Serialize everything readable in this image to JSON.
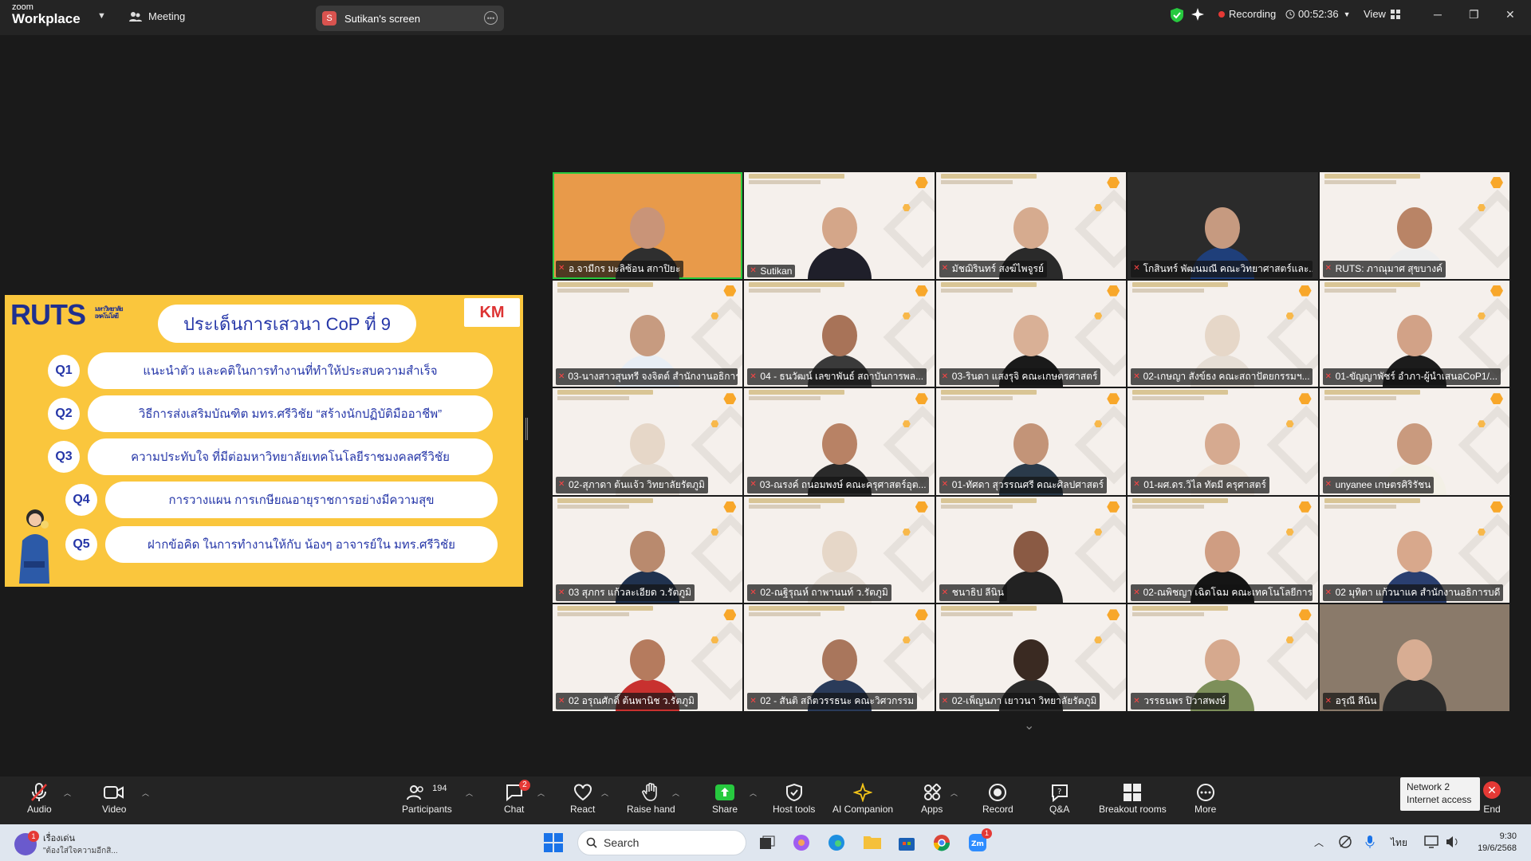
{
  "app": {
    "brand_small": "zoom",
    "brand_big": "Workplace",
    "meeting_label": "Meeting"
  },
  "share_tab": {
    "initial": "S",
    "title": "Sutikan's screen"
  },
  "status": {
    "recording": "Recording",
    "timer": "00:52:36",
    "view": "View"
  },
  "slide": {
    "logo": "RUTS",
    "logo_sub": "มหาวิทยาลัยเทคโนโลยี",
    "km_logo": "KM",
    "title": "ประเด็นการเสวนา CoP ที่ 9",
    "questions": [
      {
        "id": "Q1",
        "text": "แนะนำตัว และคติในการทำงานที่ทำให้ประสบความสำเร็จ"
      },
      {
        "id": "Q2",
        "text": "วิธีการส่งเสริมบัณฑิต มทร.ศรีวิชัย “สร้างนักปฏิบัติมืออาชีพ”"
      },
      {
        "id": "Q3",
        "text": "ความประทับใจ ที่มีต่อมหาวิทยาลัยเทคโนโลยีราชมงคลศรีวิชัย"
      },
      {
        "id": "Q4",
        "text": "การวางแผน การเกษียณอายุราชการอย่างมีความสุข"
      },
      {
        "id": "Q5",
        "text": "ฝากข้อคิด ในการทำงานให้กับ น้องๆ อาจารย์ใน มทร.ศรีวิชัย"
      }
    ]
  },
  "participants": [
    {
      "name": "อ.จามีกร มะลิซ้อน สกาปิยะ",
      "skin": "#c99478",
      "shirt": "#2f2f2f",
      "bg": "#e89a4a"
    },
    {
      "name": "Sutikan",
      "skin": "#d4a689",
      "shirt": "#1f1f2a",
      "bg": "#f5f0ec"
    },
    {
      "name": "มัชฌิรินทร์ สงฆ์ไพจูรย์",
      "skin": "#d6ab8f",
      "shirt": "#2a2a2a",
      "bg": "#f5f0ec"
    },
    {
      "name": "โกสินทร์ พัฒนมณี คณะวิทยาศาสตร์และ...",
      "skin": "#c69a80",
      "shirt": "#1f3f7a",
      "bg": "#2b2b2b"
    },
    {
      "name": "RUTS: ภาณุมาศ สุขบางค์",
      "skin": "#b98466",
      "shirt": "#eeeeee",
      "bg": "#f5f0ec"
    },
    {
      "name": "03-นางสาวสุนทรี จงจิตต์ สำนักงานอธิการ...",
      "skin": "#c79b80",
      "shirt": "#e8eef5",
      "bg": "#f5f0ec"
    },
    {
      "name": "04 - ธนวัฒน์ เลขาพันธ์ สถาบันการพล...",
      "skin": "#a87358",
      "shirt": "#3a3a3a",
      "bg": "#f5f0ec"
    },
    {
      "name": "03-รินดา แสงรุจิ คณะเกษตรศาสตร์",
      "skin": "#d9b096",
      "shirt": "#1a1a1a",
      "bg": "#f5f0ec"
    },
    {
      "name": "02-เกษญา สังข์ธง คณะสถาปัตยกรรมฯ...",
      "skin": "#e6d7c8",
      "shirt": "#e6ded5",
      "bg": "#f5f0ec"
    },
    {
      "name": "01-ขัญญาพัชร์ อำภา-ผู้นำเสนอCoP1/...",
      "skin": "#d2a287",
      "shirt": "#1c1c1c",
      "bg": "#f5f0ec"
    },
    {
      "name": "02-สุภาดา ต้นแจ้ว วิทยาลัยรัตภูมิ",
      "skin": "#e6d7c8",
      "shirt": "#e6ded5",
      "bg": "#f5f0ec"
    },
    {
      "name": "03-ณรงค์ ถนอมพงษ์ คณะครุศาสตร์อุต...",
      "skin": "#b88265",
      "shirt": "#2a2a2a",
      "bg": "#f5f0ec"
    },
    {
      "name": "01-ทัศดา สุวรรณศรี คณะศิลปศาสตร์",
      "skin": "#c39478",
      "shirt": "#2a3a4a",
      "bg": "#f5f0ec"
    },
    {
      "name": "01-ผศ.ดร.วิไล ทัตมี ครุศาสตร์",
      "skin": "#d6aa90",
      "shirt": "#f0e6dc",
      "bg": "#f5f0ec"
    },
    {
      "name": "unyanee เกษตรศิริรัชน",
      "skin": "#c99a7e",
      "shirt": "#f3f0e6",
      "bg": "#f5f0ec"
    },
    {
      "name": "03 สุภกร แก้วละเอียด ว.รัตภูมิ",
      "skin": "#b98a6e",
      "shirt": "#20324f",
      "bg": "#f5f0ec"
    },
    {
      "name": "02-ณฐิรุณห์ ถาพานนท์ ว.รัตภูมิ",
      "skin": "#e6d7c8",
      "shirt": "#e6ded5",
      "bg": "#f5f0ec"
    },
    {
      "name": "ชนาธิป ลีนิน",
      "skin": "#8a5a44",
      "shirt": "#222222",
      "bg": "#f5f0ec"
    },
    {
      "name": "02-ณพิชญา เฉิดโฉม คณะเทคโนโลยีการจั...",
      "skin": "#cf9d82",
      "shirt": "#151515",
      "bg": "#f5f0ec"
    },
    {
      "name": "02 มุทิตา แก้วนาแค สำนักงานอธิการบดี",
      "skin": "#d8a88c",
      "shirt": "#2a3f70",
      "bg": "#f5f0ec"
    },
    {
      "name": "02 อรุณศักดิ์ ต้นพานิช ว.รัตภูมิ",
      "skin": "#b57b5e",
      "shirt": "#c8312f",
      "bg": "#f5f0ec"
    },
    {
      "name": "02 - สันติ สถิตวรรธนะ คณะวิศวกรรม",
      "skin": "#a9765c",
      "shirt": "#2a3b5a",
      "bg": "#f5f0ec"
    },
    {
      "name": "02-เพ็ญนภา เยาวนา วิทยาลัยรัตภูมิ",
      "skin": "#3a2a22",
      "shirt": "#2a2a2a",
      "bg": "#f5f0ec"
    },
    {
      "name": "วรรธนพร ปิวาสพงษ์",
      "skin": "#d6a98e",
      "shirt": "#7d8f5a",
      "bg": "#f5f0ec"
    },
    {
      "name": "อรุณี ลีนิน",
      "skin": "#d8ad93",
      "shirt": "#2a2a2a",
      "bg": "#8a7a6a"
    }
  ],
  "toolbar": {
    "audio": "Audio",
    "video": "Video",
    "participants": "Participants",
    "participants_count": "194",
    "chat": "Chat",
    "chat_badge": "2",
    "react": "React",
    "raise_hand": "Raise hand",
    "share": "Share",
    "host_tools": "Host tools",
    "ai_companion": "AI Companion",
    "apps": "Apps",
    "record": "Record",
    "qa": "Q&A",
    "breakout": "Breakout rooms",
    "more": "More",
    "end": "End"
  },
  "network": {
    "line1": "Network 2",
    "line2": "Internet access"
  },
  "taskbar": {
    "notif_title": "เรื่องเด่น",
    "notif_sub": "\"ต้องใส่ใจความอีกสิ...",
    "notif_badge": "1",
    "search": "Search",
    "zoom_badge": "1",
    "lang": "ไทย",
    "time": "9:30",
    "date": "19/6/2568"
  }
}
